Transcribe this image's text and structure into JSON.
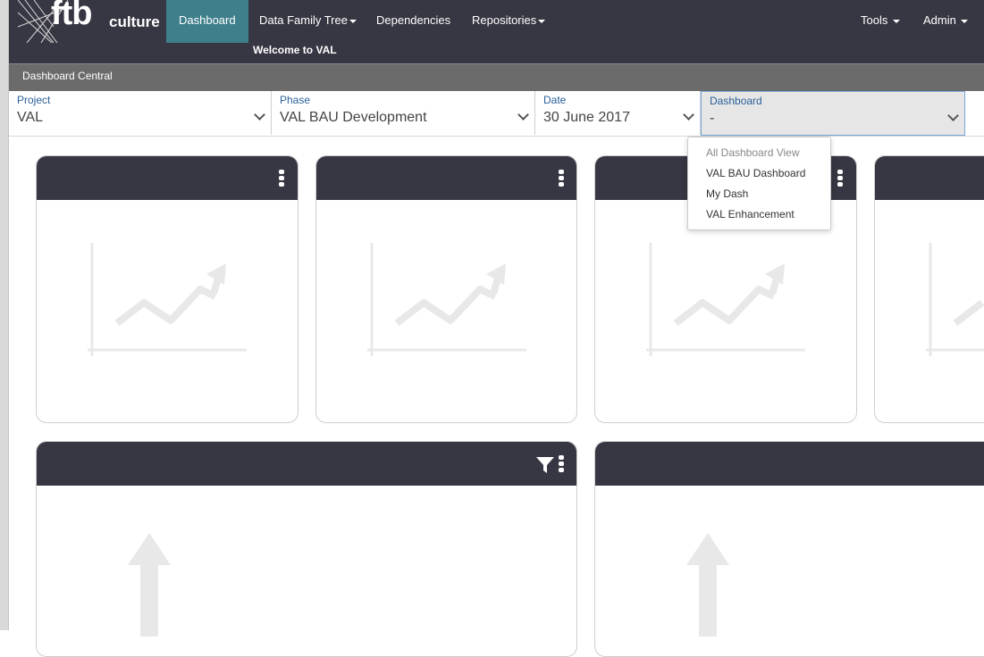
{
  "brand": {
    "ftb": "ftb",
    "culture": "culture"
  },
  "nav": {
    "items": [
      {
        "label": "Dashboard",
        "active": true,
        "caret": false
      },
      {
        "label": "Data Family Tree",
        "active": false,
        "caret": true
      },
      {
        "label": "Dependencies",
        "active": false,
        "caret": false
      },
      {
        "label": "Repositories",
        "active": false,
        "caret": true
      }
    ],
    "right": [
      {
        "label": "Tools",
        "caret": true
      },
      {
        "label": "Admin",
        "caret": true
      }
    ],
    "welcome": "Welcome to VAL"
  },
  "subheader": {
    "title": "Dashboard Central"
  },
  "filters": {
    "project": {
      "label": "Project",
      "value": "VAL"
    },
    "phase": {
      "label": "Phase",
      "value": "VAL BAU Development"
    },
    "date": {
      "label": "Date",
      "value": "30 June 2017"
    },
    "dashboard": {
      "label": "Dashboard",
      "value": "-"
    }
  },
  "dashboard_dropdown": {
    "options": [
      "All Dashboard View",
      "VAL BAU Dashboard",
      "My Dash",
      "VAL Enhancement"
    ]
  },
  "colors": {
    "navbar": "#373743",
    "active_tab": "#3f7f8b",
    "subheader": "#6b6b6b",
    "card_header": "#373743",
    "label_blue": "#2a6099",
    "placeholder": "#e8e8e8"
  },
  "icons": [
    "kebab-menu-icon",
    "filter-icon",
    "chevron-down-icon",
    "line-chart-placeholder-icon",
    "up-arrow-placeholder-icon"
  ]
}
